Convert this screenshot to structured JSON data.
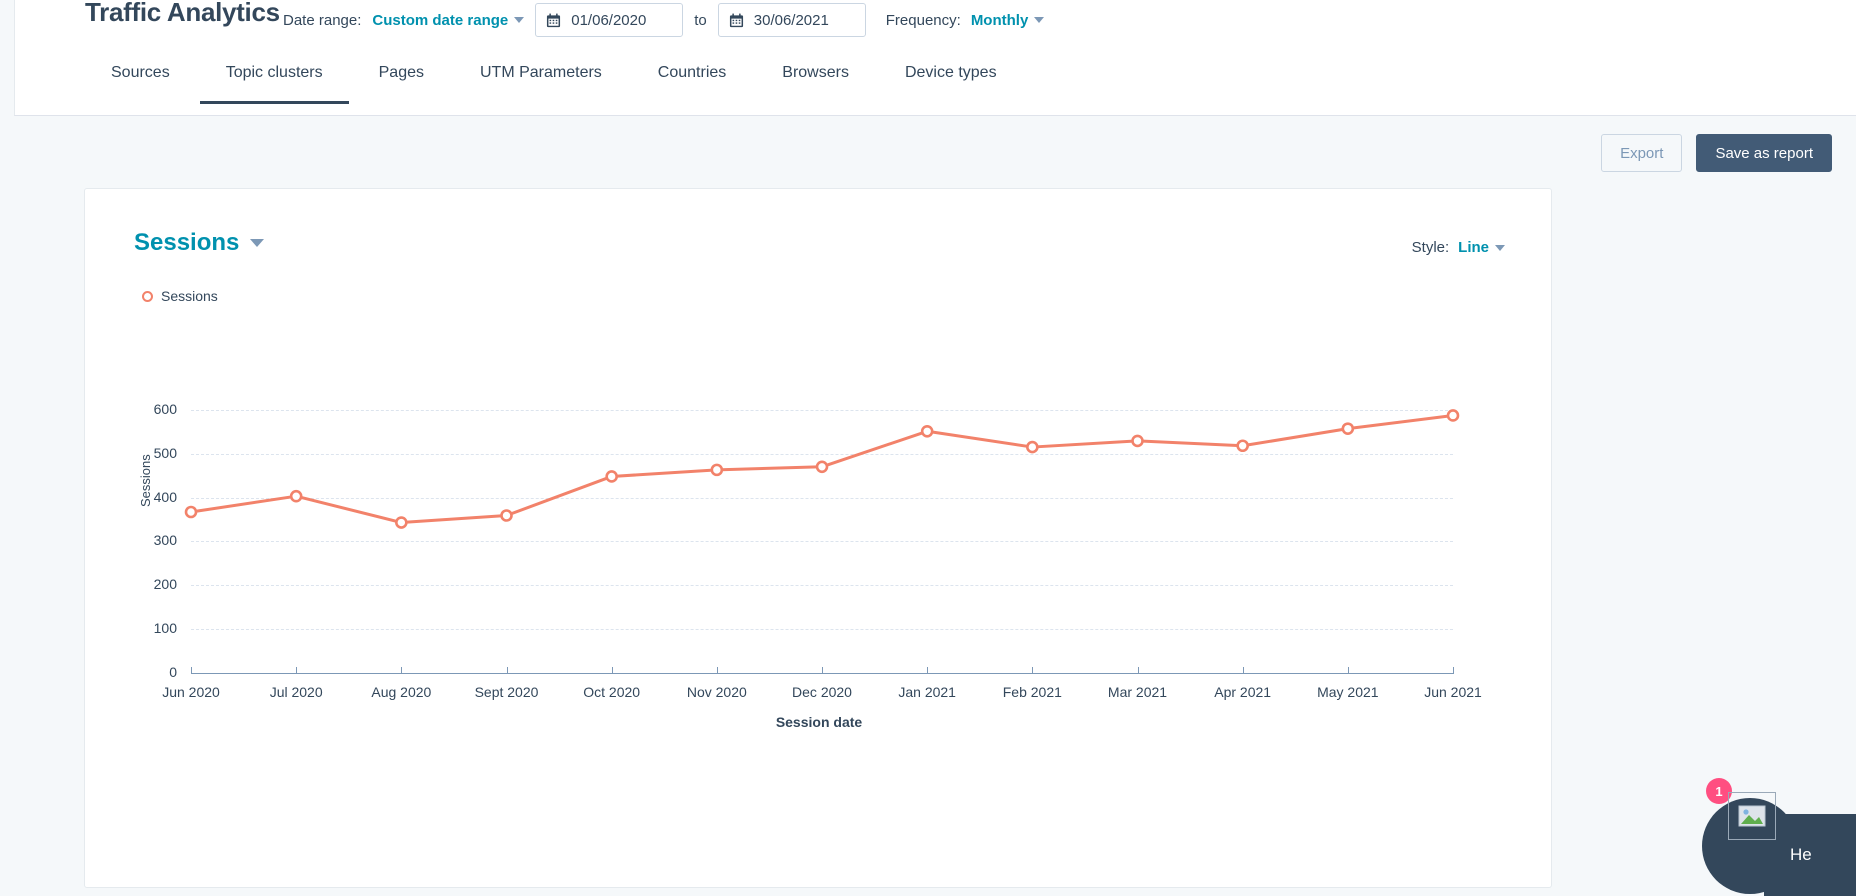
{
  "header": {
    "title": "Traffic Analytics",
    "date_range_label": "Date range:",
    "date_range_value": "Custom date range",
    "date_from": "01/06/2020",
    "date_to": "30/06/2021",
    "to_label": "to",
    "frequency_label": "Frequency:",
    "frequency_value": "Monthly"
  },
  "tabs": [
    {
      "label": "Sources",
      "active": false
    },
    {
      "label": "Topic clusters",
      "active": true
    },
    {
      "label": "Pages",
      "active": false
    },
    {
      "label": "UTM Parameters",
      "active": false
    },
    {
      "label": "Countries",
      "active": false
    },
    {
      "label": "Browsers",
      "active": false
    },
    {
      "label": "Device types",
      "active": false
    }
  ],
  "actions": {
    "export_label": "Export",
    "save_label": "Save as report"
  },
  "card": {
    "metric_title": "Sessions",
    "style_label": "Style:",
    "style_value": "Line"
  },
  "chat": {
    "badge_count": "1",
    "message": "He"
  },
  "colors": {
    "accent_teal": "#0091ae",
    "series_orange": "#f2826a",
    "dark_navy": "#33475b",
    "primary_button": "#425b76",
    "badge_pink": "#ff4f81"
  },
  "chart_data": {
    "type": "line",
    "title": "Sessions",
    "xlabel": "Session date",
    "ylabel": "Sessions",
    "ylim": [
      0,
      620
    ],
    "y_ticks": [
      0,
      100,
      200,
      300,
      400,
      500,
      600
    ],
    "grid": true,
    "legend_position": "top-left",
    "categories": [
      "Jun 2020",
      "Jul 2020",
      "Aug 2020",
      "Sept 2020",
      "Oct 2020",
      "Nov 2020",
      "Dec 2020",
      "Jan 2021",
      "Feb 2021",
      "Mar 2021",
      "Apr 2021",
      "May 2021",
      "Jun 2021"
    ],
    "series": [
      {
        "name": "Sessions",
        "color": "#f2826a",
        "values": [
          367,
          403,
          343,
          359,
          448,
          463,
          470,
          551,
          515,
          529,
          518,
          557,
          587
        ]
      }
    ]
  }
}
